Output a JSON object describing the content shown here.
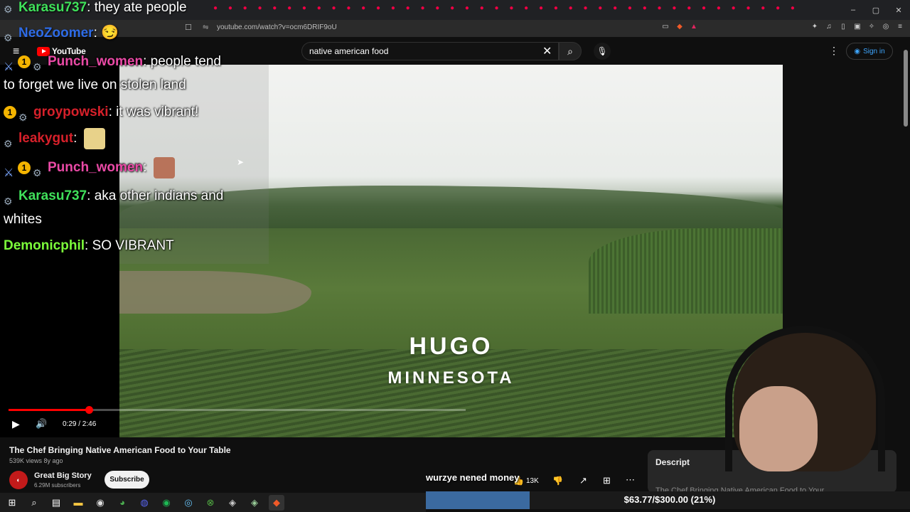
{
  "browser": {
    "url": "youtube.com/watch?v=ocm6DRIF9oU",
    "window_controls": [
      "–",
      "▢",
      "✕"
    ]
  },
  "youtube": {
    "logo_text": "YouTube",
    "search_value": "native american food",
    "signin_label": "Sign in"
  },
  "video": {
    "overlay_title": "HUGO",
    "overlay_subtitle": "MINNESOTA",
    "current_time": "0:29 / 2:46",
    "progress_fraction": 0.176,
    "title": "The Chef Bringing Native American Food to Your Table",
    "meta": "539K views  8y ago",
    "channel_name": "Great Big Story",
    "channel_subs": "6.29M subscribers",
    "subscribe_label": "Subscribe",
    "like_count": "13K",
    "description_label": "Descript",
    "description_text": "The Chef Bringing Native American Food to Your"
  },
  "chat": {
    "top_message": {
      "user": "Karasu737",
      "text": "they ate people"
    },
    "neo_user": "NeoZoomer",
    "messages": [
      {
        "user": "Punch_women",
        "text": "people tend",
        "cont": "to forget we live on stolen land"
      },
      {
        "user": "groypowski",
        "text": "it was vibrant!"
      },
      {
        "user": "leakygut",
        "text": ""
      },
      {
        "user": "Punch_women",
        "text": ""
      },
      {
        "user": "Karasu737",
        "text": "aka other indians and",
        "cont": "whites"
      },
      {
        "user": "Demonicphil",
        "text": "SO VIBRANT"
      }
    ],
    "badge_value": "1"
  },
  "stream": {
    "donation_text": "wurzye nened money",
    "goal_text": "$63.77/$300.00 (21%)",
    "goal_fraction": 0.2126
  },
  "colors": {
    "accent": "#ff0000",
    "goal_fill": "#3b6aa0",
    "link": "#3ea6ff"
  }
}
